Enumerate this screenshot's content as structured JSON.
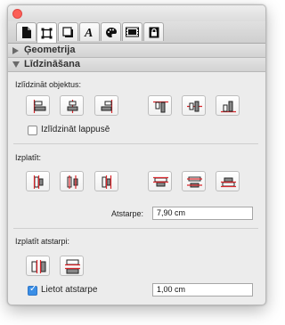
{
  "palette": {
    "title": "Ģeometrija",
    "section_open": "Līdzināšana",
    "tabs": [
      {
        "icon": "document-icon",
        "active": false
      },
      {
        "icon": "geometry-frame-icon",
        "active": true
      },
      {
        "icon": "shadow-box-icon",
        "active": false
      },
      {
        "icon": "text-italic-a-icon",
        "active": false
      },
      {
        "icon": "color-palette-icon",
        "active": false
      },
      {
        "icon": "slideshow-icon",
        "active": false
      },
      {
        "icon": "lock-icon",
        "active": false
      }
    ]
  },
  "align": {
    "heading": "Izlīdzināt objektus:",
    "page_checkbox_label": "Izlīdzināt lappusē",
    "page_checkbox_checked": false
  },
  "distribute": {
    "heading": "Izplatīt:",
    "spacing_label": "Atstarpe:",
    "spacing_value": "7,90 cm"
  },
  "distribute_spacing": {
    "heading": "Izplatīt atstarpi:",
    "use_spacing_label": "Lietot atstarpe",
    "use_spacing_checked": true,
    "spacing_value": "1,00 cm"
  },
  "colors": {
    "accent_red": "#d9262b",
    "checkbox_blue": "#3a8ee6",
    "close_button": "#fc5f57"
  }
}
